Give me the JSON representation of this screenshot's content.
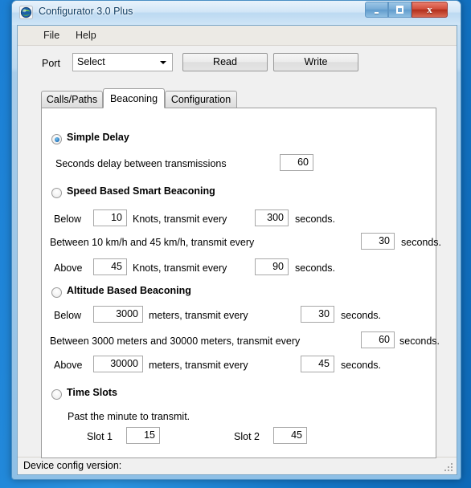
{
  "window": {
    "title": "Configurator 3.0 Plus",
    "icon": "app-globe-icon",
    "minimize_label": "",
    "maximize_label": "",
    "close_label": "x"
  },
  "menubar": {
    "items": [
      {
        "label": "File"
      },
      {
        "label": "Help"
      }
    ]
  },
  "toolbar": {
    "port_label": "Port",
    "port_value": "Select",
    "read_label": "Read",
    "write_label": "Write"
  },
  "tabs": [
    {
      "label": "Calls/Paths",
      "active": false
    },
    {
      "label": "Beaconing",
      "active": true
    },
    {
      "label": "Configuration",
      "active": false
    }
  ],
  "beaconing": {
    "simple_delay": {
      "title": "Simple Delay",
      "selected": true,
      "delay_label": "Seconds delay between transmissions",
      "delay_value": "60"
    },
    "speed_based": {
      "title": "Speed Based Smart Beaconing",
      "selected": false,
      "below_label": "Below",
      "below_value": "10",
      "below_units_label": "Knots, transmit every",
      "below_seconds_value": "300",
      "below_seconds_label": "seconds.",
      "between_label": "Between 10 km/h and 45 km/h, transmit every",
      "between_seconds_value": "30",
      "between_seconds_label": "seconds.",
      "above_label": "Above",
      "above_value": "45",
      "above_units_label": "Knots, transmit every",
      "above_seconds_value": "90",
      "above_seconds_label": "seconds."
    },
    "altitude_based": {
      "title": "Altitude Based Beaconing",
      "selected": false,
      "below_label": "Below",
      "below_value": "3000",
      "below_units_label": "meters, transmit every",
      "below_seconds_value": "30",
      "below_seconds_label": "seconds.",
      "between_label": "Between 3000 meters and 30000 meters, transmit every",
      "between_seconds_value": "60",
      "between_seconds_label": "seconds.",
      "above_label": "Above",
      "above_value": "30000",
      "above_units_label": "meters, transmit every",
      "above_seconds_value": "45",
      "above_seconds_label": "seconds."
    },
    "time_slots": {
      "title": "Time Slots",
      "selected": false,
      "description": "Past the minute to transmit.",
      "slot1_label": "Slot 1",
      "slot1_value": "15",
      "slot2_label": "Slot 2",
      "slot2_value": "45"
    }
  },
  "statusbar": {
    "text": "Device config version:"
  },
  "colors": {
    "accent": "#2070b8",
    "close_button": "#b22f1c",
    "titlebar": "#d2e6f7",
    "panel": "#f0f0f0"
  }
}
